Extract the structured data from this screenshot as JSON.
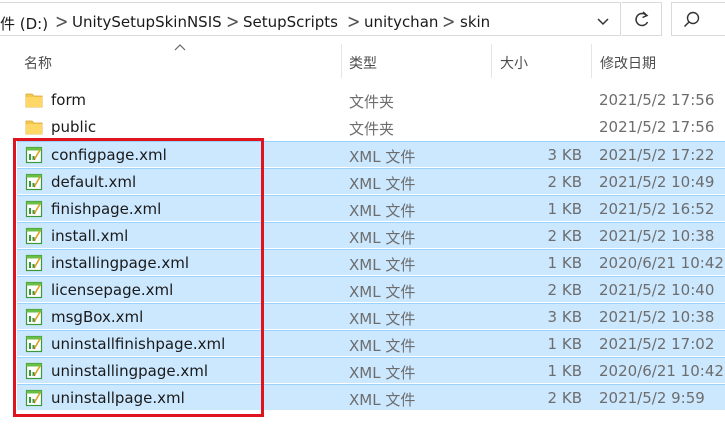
{
  "address": {
    "segments": [
      "件 (D:)",
      "UnitySetupSkinNSIS",
      "SetupScripts",
      "unitychan",
      "skin"
    ],
    "separator": ">"
  },
  "columns": {
    "name": "名称",
    "type": "类型",
    "size": "大小",
    "date": "修改日期"
  },
  "files": [
    {
      "name": "form",
      "type": "文件夹",
      "size": "",
      "date": "2021/5/2 17:56",
      "icon": "folder-icon",
      "selected": false
    },
    {
      "name": "public",
      "type": "文件夹",
      "size": "",
      "date": "2021/5/2 17:56",
      "icon": "folder-icon",
      "selected": false
    },
    {
      "name": "configpage.xml",
      "type": "XML 文件",
      "size": "3 KB",
      "date": "2021/5/2 17:22",
      "icon": "xml-file-icon",
      "selected": true
    },
    {
      "name": "default.xml",
      "type": "XML 文件",
      "size": "2 KB",
      "date": "2021/5/2 10:49",
      "icon": "xml-file-icon",
      "selected": true
    },
    {
      "name": "finishpage.xml",
      "type": "XML 文件",
      "size": "1 KB",
      "date": "2021/5/2 16:52",
      "icon": "xml-file-icon",
      "selected": true
    },
    {
      "name": "install.xml",
      "type": "XML 文件",
      "size": "2 KB",
      "date": "2021/5/2 10:38",
      "icon": "xml-file-icon",
      "selected": true
    },
    {
      "name": "installingpage.xml",
      "type": "XML 文件",
      "size": "1 KB",
      "date": "2020/6/21 10:42",
      "icon": "xml-file-icon",
      "selected": true
    },
    {
      "name": "licensepage.xml",
      "type": "XML 文件",
      "size": "2 KB",
      "date": "2021/5/2 10:40",
      "icon": "xml-file-icon",
      "selected": true
    },
    {
      "name": "msgBox.xml",
      "type": "XML 文件",
      "size": "3 KB",
      "date": "2021/5/2 10:38",
      "icon": "xml-file-icon",
      "selected": true
    },
    {
      "name": "uninstallfinishpage.xml",
      "type": "XML 文件",
      "size": "1 KB",
      "date": "2021/5/2 17:02",
      "icon": "xml-file-icon",
      "selected": true
    },
    {
      "name": "uninstallingpage.xml",
      "type": "XML 文件",
      "size": "1 KB",
      "date": "2020/6/21 10:42",
      "icon": "xml-file-icon",
      "selected": true
    },
    {
      "name": "uninstallpage.xml",
      "type": "XML 文件",
      "size": "2 KB",
      "date": "2021/5/2 9:59",
      "icon": "xml-file-icon",
      "selected": true
    }
  ],
  "colors": {
    "selection": "#cce8ff",
    "selection_border": "#99d1ff",
    "highlight": "#e0141e",
    "folder": "#f5c84c"
  }
}
